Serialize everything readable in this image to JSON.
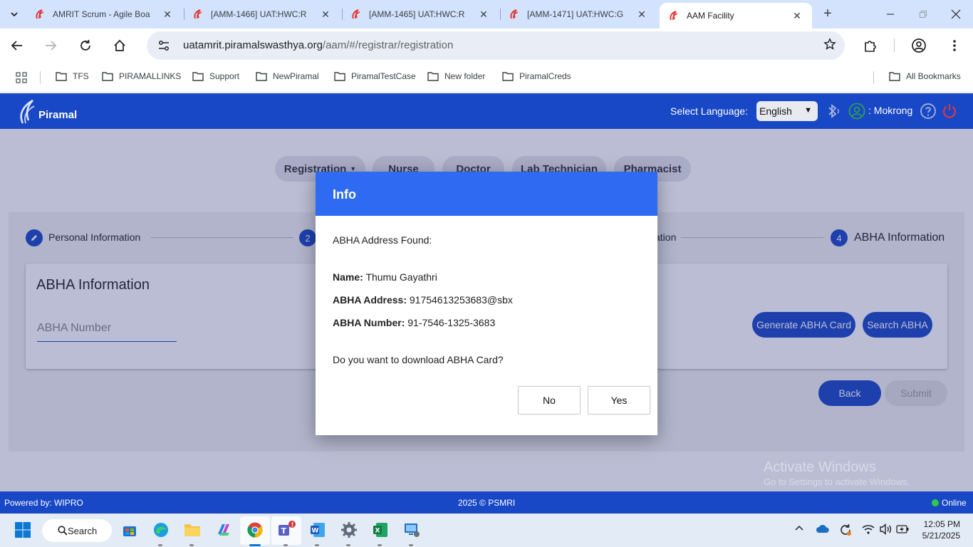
{
  "browser": {
    "tabs": [
      {
        "title": "AMRIT Scrum - Agile Boa",
        "active": false
      },
      {
        "title": "[AMM-1466] UAT:HWC:R",
        "active": false
      },
      {
        "title": "[AMM-1465] UAT:HWC:R",
        "active": false
      },
      {
        "title": "[AMM-1471] UAT:HWC:G",
        "active": false
      },
      {
        "title": "AAM Facility",
        "active": true
      }
    ],
    "url_host": "uatamrit.piramalswasthya.org",
    "url_path": "/aam/#/registrar/registration",
    "bookmarks": [
      "TFS",
      "PIRAMALLINKS",
      "Support",
      "NewPiramal",
      "PiramalTestCase",
      "New folder",
      "PiramalCreds"
    ],
    "all_bookmarks": "All Bookmarks"
  },
  "header": {
    "logo_text": "Piramal",
    "language_label": "Select Language:",
    "language_value": "English",
    "user_label": ": Mokrong",
    "brand_color": "#1948c6"
  },
  "nav": {
    "tabs": [
      "Registration",
      "Nurse",
      "Doctor",
      "Lab Technician",
      "Pharmacist"
    ],
    "dropdown_icon": "caret-down-icon"
  },
  "stepper": {
    "steps": [
      {
        "number": "",
        "label": "Personal Information",
        "icon": "pencil-icon"
      },
      {
        "number": "2",
        "label": ""
      },
      {
        "number": "",
        "label": "ation"
      },
      {
        "number": "4",
        "label": "ABHA Information"
      }
    ]
  },
  "abha_section": {
    "title": "ABHA Information",
    "input_placeholder": "ABHA Number",
    "generate_button": "Generate ABHA Card",
    "search_button": "Search ABHA",
    "back_button": "Back",
    "submit_button": "Submit"
  },
  "dialog": {
    "title": "Info",
    "found_text": "ABHA Address Found:",
    "name_label": "Name:",
    "name_value": "Thumu Gayathri",
    "address_label": "ABHA Address:",
    "address_value": "91754613253683@sbx",
    "number_label": "ABHA Number:",
    "number_value": "91-7546-1325-3683",
    "question": "Do you want to download ABHA Card?",
    "no_button": "No",
    "yes_button": "Yes",
    "header_color": "#2e6bf2"
  },
  "watermark": {
    "line1": "Activate Windows",
    "line2": "Go to Settings to activate Windows."
  },
  "footer": {
    "left": "Powered by: WIPRO",
    "center": "2025 © PSMRI",
    "right": "Online"
  },
  "taskbar": {
    "search_label": "Search",
    "time": "12:05 PM",
    "date": "5/21/2025"
  }
}
